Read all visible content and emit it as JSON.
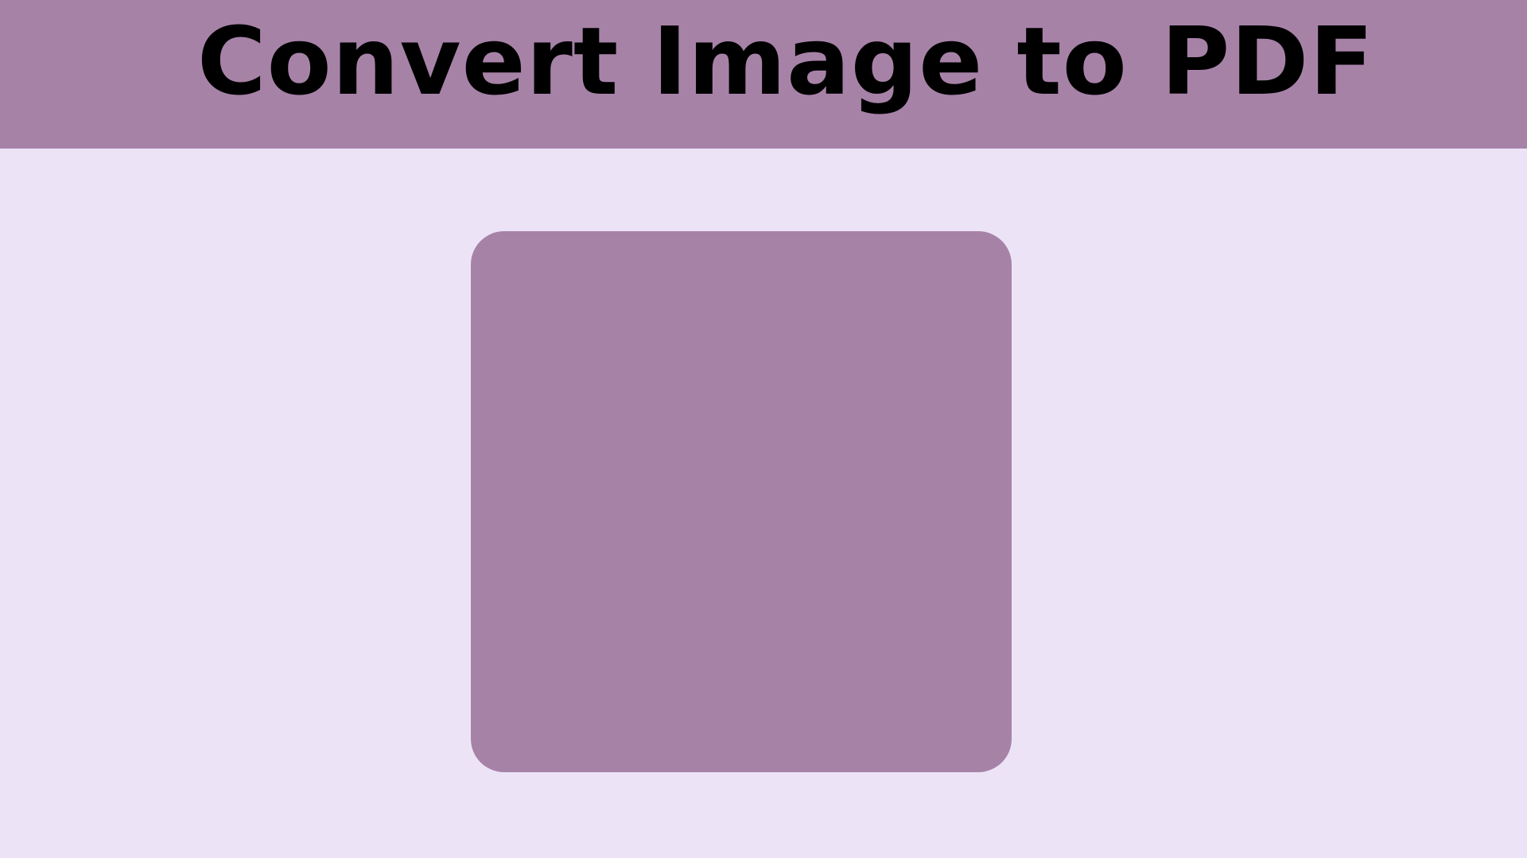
{
  "header": {
    "title": "Convert Image to PDF"
  },
  "colors": {
    "page_background": "#ECE3F7",
    "header_background": "#A782A7",
    "drop_zone_background": "#A782A7",
    "title_text": "#000000"
  }
}
